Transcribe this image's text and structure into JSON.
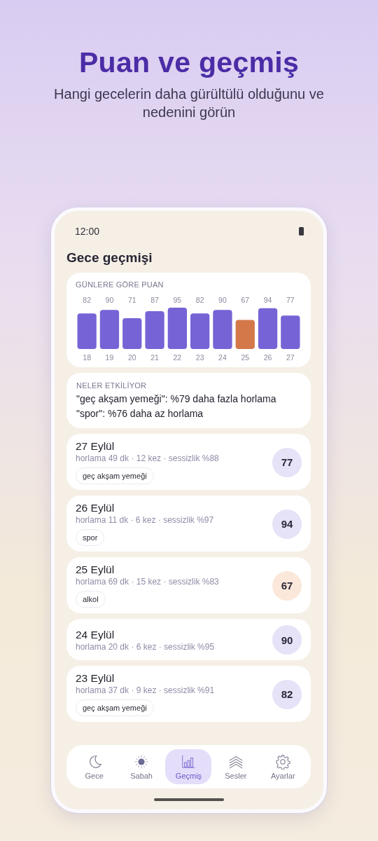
{
  "header": {
    "title": "Puan ve geçmiş",
    "subtitle": "Hangi gecelerin daha gürültülü olduğunu ve nedenini görün"
  },
  "status_bar": {
    "time": "12:00"
  },
  "screen_title": "Gece geçmişi",
  "score_card": {
    "title": "GÜNLERE GÖRE PUAN",
    "chart_data": {
      "type": "bar",
      "data_labels": true,
      "categories": [
        "18",
        "19",
        "20",
        "21",
        "22",
        "23",
        "24",
        "25",
        "26",
        "27"
      ],
      "series": [
        {
          "color": "#7664d6",
          "values": [
            82,
            90,
            71,
            87,
            95,
            82,
            90,
            67,
            94,
            77
          ],
          "colors": [
            null,
            null,
            null,
            null,
            null,
            null,
            null,
            "#d4784a",
            null,
            null
          ]
        }
      ]
    }
  },
  "factors": {
    "title": "NELER ETKİLİYOR",
    "lines": [
      "\"geç akşam yemeği\": %79 daha fazla horlama",
      "\"spor\": %76 daha az horlama"
    ]
  },
  "nights": [
    {
      "date": "27 Eylül",
      "stats": "horlama 49 dk · 12 kez · sessizlik %88",
      "tags": [
        "geç akşam yemeği"
      ],
      "score": "77",
      "color": "#e6e2f7"
    },
    {
      "date": "26 Eylül",
      "stats": "horlama 11 dk · 6 kez · sessizlik %97",
      "tags": [
        "spor"
      ],
      "score": "94",
      "color": "#e6e2f7"
    },
    {
      "date": "25 Eylül",
      "stats": "horlama 69 dk · 15 kez · sessizlik %83",
      "tags": [
        "alkol"
      ],
      "score": "67",
      "color": "#fbe8da"
    },
    {
      "date": "24 Eylül",
      "stats": "horlama 20 dk · 6 kez · sessizlik %95",
      "score": "90",
      "color": "#e6e2f7"
    },
    {
      "date": "23 Eylül",
      "stats": "horlama 37 dk · 9 kez · sessizlik %91",
      "tags": [
        "geç akşam yemeği"
      ],
      "score": "82",
      "color": "#e6e2f7"
    }
  ],
  "nav": [
    {
      "label": "Gece",
      "selected": false
    },
    {
      "label": "Sabah",
      "selected": false
    },
    {
      "label": "Geçmiş",
      "selected": true
    },
    {
      "label": "Sesler",
      "selected": false
    },
    {
      "label": "Ayarlar",
      "selected": false
    }
  ]
}
